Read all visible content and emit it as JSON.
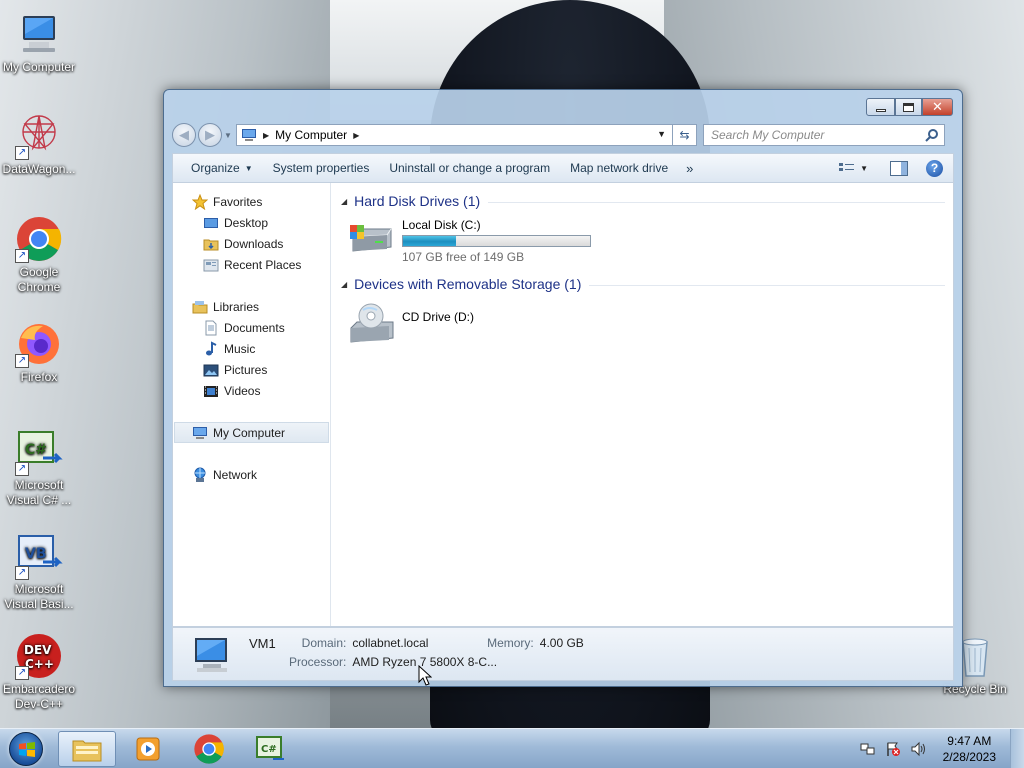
{
  "desktop": {
    "icons": [
      {
        "label": "My Computer",
        "icon": "computer-icon"
      },
      {
        "label": "DataWagon...",
        "icon": "datawagon-icon"
      },
      {
        "label": "Google Chrome",
        "icon": "chrome-icon"
      },
      {
        "label": "Firefox",
        "icon": "firefox-icon"
      },
      {
        "label": "Microsoft Visual C# ...",
        "icon": "visual-csharp-icon"
      },
      {
        "label": "Microsoft Visual Basi...",
        "icon": "visual-basic-icon"
      },
      {
        "label": "Embarcadero Dev-C++",
        "icon": "devcpp-icon"
      },
      {
        "label": "Recycle Bin",
        "icon": "recycle-bin-icon"
      }
    ]
  },
  "window": {
    "address": {
      "segment": "My Computer"
    },
    "search": {
      "placeholder": "Search My Computer"
    },
    "toolbar": {
      "organize": "Organize",
      "system_properties": "System properties",
      "uninstall": "Uninstall or change a program",
      "map_drive": "Map network drive",
      "more": "»"
    },
    "navpane": {
      "favorites": "Favorites",
      "favorites_items": [
        "Desktop",
        "Downloads",
        "Recent Places"
      ],
      "libraries": "Libraries",
      "libraries_items": [
        "Documents",
        "Music",
        "Pictures",
        "Videos"
      ],
      "computer": "My Computer",
      "network": "Network"
    },
    "groups": {
      "hdd_header": "Hard Disk Drives (1)",
      "removable_header": "Devices with Removable Storage (1)"
    },
    "drives": {
      "local_name": "Local Disk (C:)",
      "local_free": "107 GB free of 149 GB",
      "local_used_fraction": 0.282,
      "cd_name": "CD Drive (D:)"
    },
    "details": {
      "name": "VM1",
      "domain_label": "Domain:",
      "domain_value": "collabnet.local",
      "memory_label": "Memory:",
      "memory_value": "4.00 GB",
      "processor_label": "Processor:",
      "processor_value": "AMD Ryzen 7 5800X 8-C..."
    }
  },
  "taskbar": {
    "clock_time": "9:47 AM",
    "clock_date": "2/28/2023",
    "apps": [
      "explorer-icon",
      "media-player-icon",
      "chrome-icon",
      "visual-csharp-icon"
    ]
  },
  "colors": {
    "accent": "#1e3287",
    "drive_fill": "#2aa7d6",
    "selection": "#dfe8f1"
  }
}
